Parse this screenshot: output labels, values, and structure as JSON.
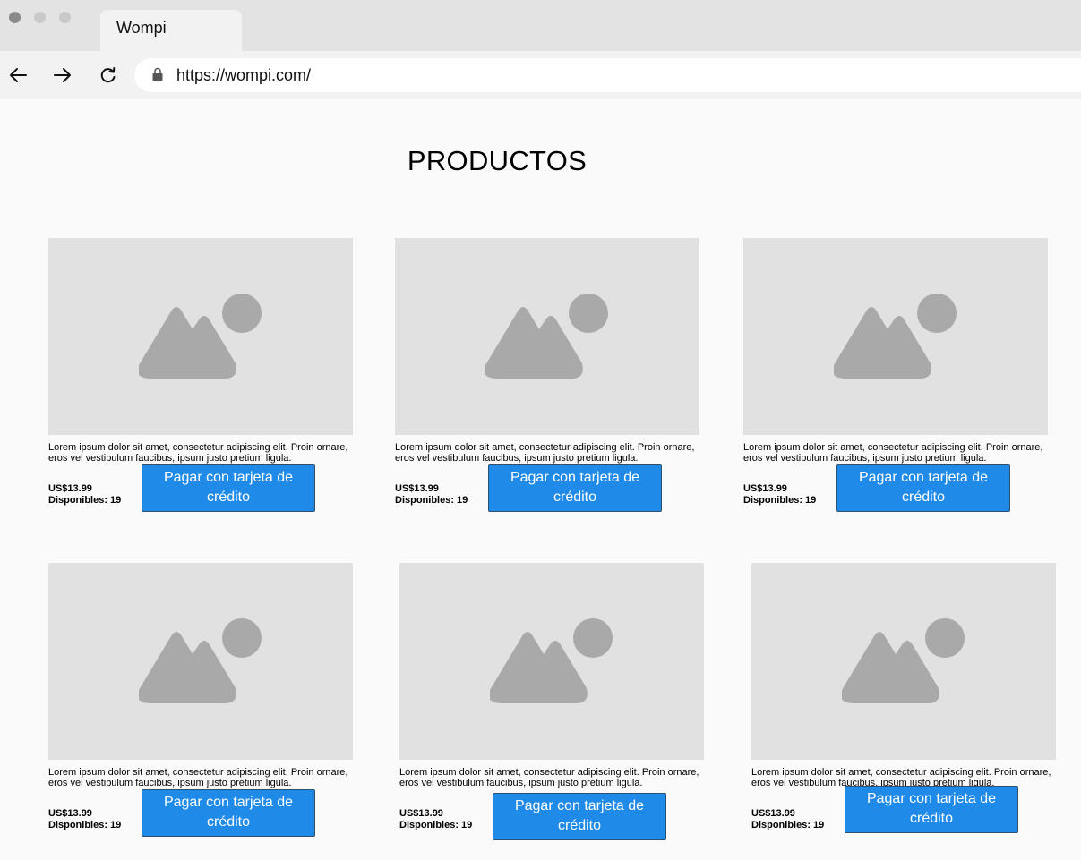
{
  "browser": {
    "tab_title": "Wompi",
    "url": "https://wompi.com/"
  },
  "page": {
    "title": "PRODUCTOS"
  },
  "products": [
    {
      "description": "Lorem ipsum dolor sit amet, consectetur adipiscing elit. Proin ornare, eros vel vestibulum faucibus, ipsum justo pretium ligula.",
      "price": "US$13.99",
      "stock": "Disponibles: 19",
      "button_label": "Pagar con tarjeta de crédito"
    },
    {
      "description": "Lorem ipsum dolor sit amet, consectetur adipiscing elit. Proin ornare, eros vel vestibulum faucibus, ipsum justo pretium ligula.",
      "price": "US$13.99",
      "stock": "Disponibles: 19",
      "button_label": "Pagar con tarjeta de crédito"
    },
    {
      "description": "Lorem ipsum dolor sit amet, consectetur adipiscing elit. Proin ornare, eros vel vestibulum faucibus, ipsum justo pretium ligula.",
      "price": "US$13.99",
      "stock": "Disponibles: 19",
      "button_label": "Pagar con tarjeta de crédito"
    },
    {
      "description": "Lorem ipsum dolor sit amet, consectetur adipiscing elit. Proin ornare, eros vel vestibulum faucibus, ipsum justo pretium ligula.",
      "price": "US$13.99",
      "stock": "Disponibles: 19",
      "button_label": "Pagar con tarjeta de crédito"
    },
    {
      "description": "Lorem ipsum dolor sit amet, consectetur adipiscing elit. Proin ornare, eros vel vestibulum faucibus, ipsum justo pretium ligula.",
      "price": "US$13.99",
      "stock": "Disponibles: 19",
      "button_label": "Pagar con tarjeta de crédito"
    },
    {
      "description": "Lorem ipsum dolor sit amet, consectetur adipiscing elit. Proin ornare, eros vel vestibulum faucibus, ipsum justo pretium ligula.",
      "price": "US$13.99",
      "stock": "Disponibles: 19",
      "button_label": "Pagar con tarjeta de crédito"
    }
  ],
  "icons": {
    "back": "arrow-left-icon",
    "forward": "arrow-right-icon",
    "reload": "reload-icon",
    "lock": "lock-icon",
    "product_image": "image-placeholder-icon"
  },
  "colors": {
    "button_bg": "#1f8ae8",
    "button_text": "#ffffff",
    "image_placeholder_bg": "#e1e1e1",
    "image_placeholder_icon": "#a9a9a9"
  }
}
